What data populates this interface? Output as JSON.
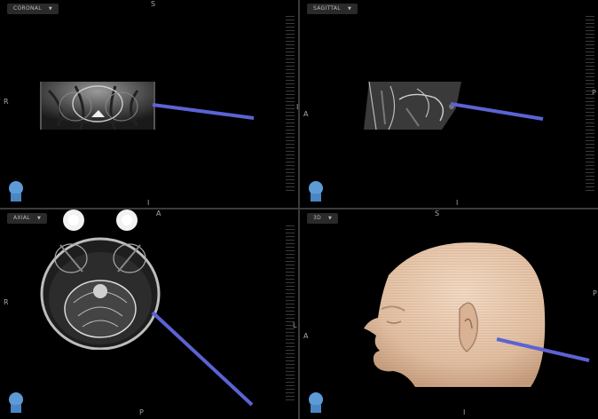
{
  "viewports": {
    "coronal": {
      "view_label": "CORONAL",
      "top": "S",
      "left": "R",
      "right": "L",
      "bottom": "I"
    },
    "sagittal": {
      "view_label": "SAGITTAL",
      "top": "",
      "left": "A",
      "right": "P",
      "bottom": "I"
    },
    "axial": {
      "view_label": "AXIAL",
      "top": "A",
      "left": "R",
      "right": "L",
      "bottom": "P"
    },
    "threed": {
      "view_label": "3D",
      "top": "S",
      "left": "A",
      "right": "P",
      "bottom": "I"
    }
  },
  "dropdown_caret": "▼",
  "colors": {
    "pointer": "#5b63d4",
    "skin": "#e7c6aa",
    "orientation_icon": "#5c9bd6"
  }
}
